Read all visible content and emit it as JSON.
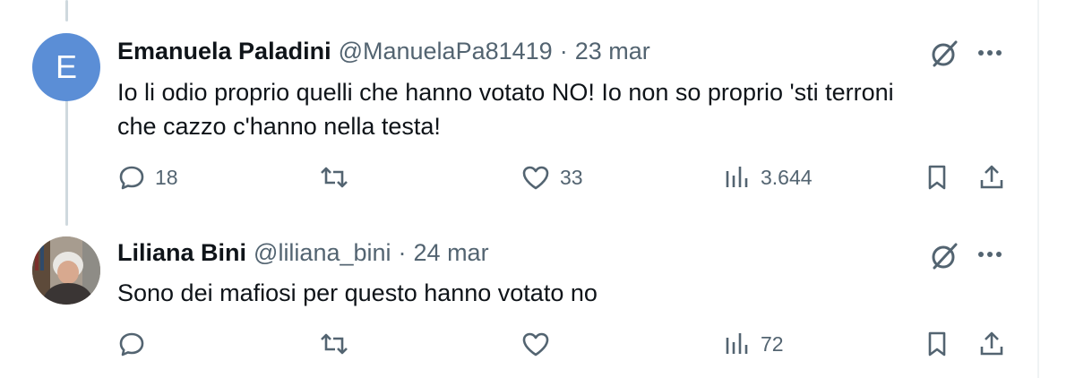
{
  "tweets": [
    {
      "avatar_letter": "E",
      "name": "Emanuela Paladini",
      "handle": "@ManuelaPa81419",
      "separator": "·",
      "date": "23 mar",
      "text_line1": "Io li odio proprio quelli che hanno votato NO! Io non so proprio 'sti terroni",
      "text_line2": "che cazzo c'hanno nella testa!",
      "replies": "18",
      "retweets": "",
      "likes": "33",
      "views": "3.644"
    },
    {
      "name": "Liliana Bini",
      "handle": "@liliana_bini",
      "separator": "·",
      "date": "24 mar",
      "text_line1": "Sono dei mafiosi per questo hanno votato no",
      "replies": "",
      "retweets": "",
      "likes": "",
      "views": "72"
    }
  ],
  "icons": {
    "grok": "grok-icon",
    "more": "more-icon",
    "reply": "reply-icon",
    "retweet": "retweet-icon",
    "like": "like-icon",
    "views": "views-icon",
    "bookmark": "bookmark-icon",
    "share": "share-icon"
  },
  "colors": {
    "text": "#0f1419",
    "secondary": "#536471",
    "thread_line": "#cfd9de",
    "avatar_bg": "#5b8ed6"
  }
}
